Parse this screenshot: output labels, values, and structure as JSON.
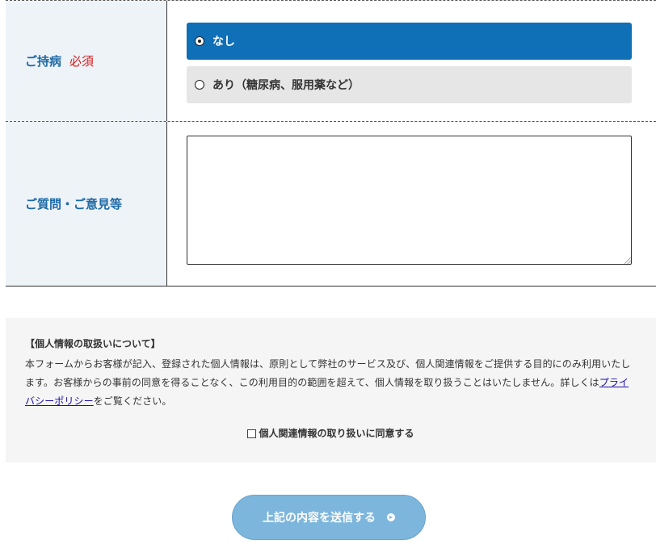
{
  "form": {
    "illness": {
      "label": "ご持病",
      "required": "必須",
      "options": [
        {
          "label": "なし",
          "selected": true
        },
        {
          "label": "あり（糖尿病、服用薬など）",
          "selected": false
        }
      ]
    },
    "questions": {
      "label": "ご質問・ご意見等",
      "value": ""
    }
  },
  "privacy": {
    "title": "【個人情報の取扱いについて】",
    "body_before_link": "本フォームからお客様が記入、登録された個人情報は、原則として弊社のサービス及び、個人関連情報をご提供する目的にのみ利用いたします。お客様からの事前の同意を得ることなく、この利用目的の範囲を超えて、個人情報を取り扱うことはいたしません。詳しくは",
    "link_text": "プライバシーポリシー",
    "body_after_link": "をご覧ください。",
    "consent_label": "個人関連情報の取り扱いに同意する"
  },
  "submit": {
    "label": "上記の内容を送信する",
    "icon": "arrow-circle-icon"
  },
  "colors": {
    "accent": "#0f6fb7",
    "label_text": "#1d6aa5",
    "required": "#d21e1e",
    "submit_bg": "#7db6dc"
  }
}
